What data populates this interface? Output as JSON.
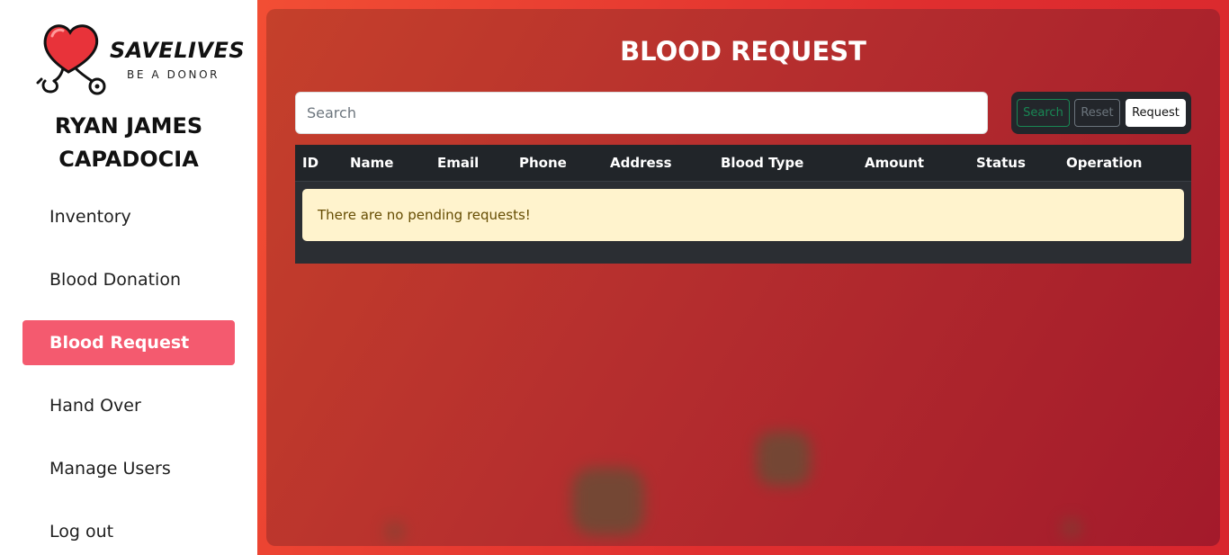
{
  "brand": {
    "name": "SAVELIVES",
    "tagline": "BE A DONOR"
  },
  "user": {
    "name_line1": "RYAN JAMES",
    "name_line2": "CAPADOCIA"
  },
  "sidebar": {
    "items": [
      {
        "label": "Inventory",
        "active": false
      },
      {
        "label": "Blood Donation",
        "active": false
      },
      {
        "label": "Blood Request",
        "active": true
      },
      {
        "label": "Hand Over",
        "active": false
      },
      {
        "label": "Manage Users",
        "active": false
      },
      {
        "label": "Log out",
        "active": false
      }
    ]
  },
  "page": {
    "title": "BLOOD REQUEST"
  },
  "search": {
    "placeholder": "Search",
    "value": ""
  },
  "buttons": {
    "search_label": "Search",
    "reset_label": "Reset",
    "request_label": "Request"
  },
  "table": {
    "columns": [
      "ID",
      "Name",
      "Email",
      "Phone",
      "Address",
      "Blood Type",
      "Amount",
      "Status",
      "Operation"
    ],
    "empty_message": "There are no pending requests!"
  },
  "colors": {
    "active_nav": "#f45a6f",
    "accent_red": "#e02f2f",
    "alert_bg": "#fff3cd",
    "table_bg": "#212529",
    "success": "#198754"
  },
  "icons": {
    "logo": "heart-stethoscope-icon"
  }
}
